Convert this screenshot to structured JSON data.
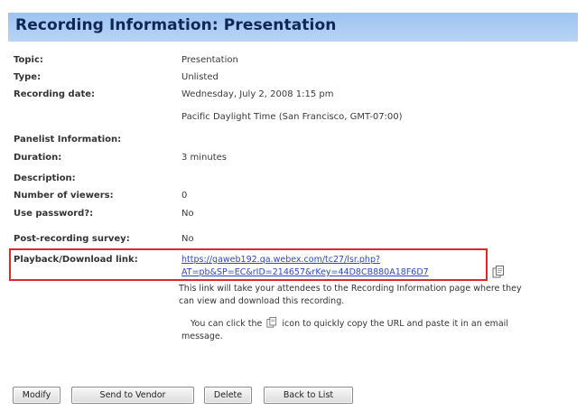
{
  "header": {
    "title": "Recording Information: Presentation"
  },
  "fields": {
    "topic": {
      "label": "Topic:",
      "value": "Presentation"
    },
    "type": {
      "label": "Type:",
      "value": "Unlisted"
    },
    "recording_date": {
      "label": "Recording date:",
      "value": "Wednesday, July 2, 2008 1:15 pm",
      "timezone": "Pacific Daylight Time (San Francisco, GMT-07:00)"
    },
    "panelist_info": {
      "label": "Panelist Information:",
      "value": ""
    },
    "duration": {
      "label": "Duration:",
      "value": "3 minutes"
    },
    "description": {
      "label": "Description:",
      "value": ""
    },
    "viewers": {
      "label": "Number of viewers:",
      "value": "0"
    },
    "use_password": {
      "label": "Use password?:",
      "value": "No"
    },
    "post_survey": {
      "label": "Post-recording survey:",
      "value": "No"
    },
    "playback": {
      "label": "Playback/Download link:",
      "link_line1": "https://gaweb192.qa.webex.com/tc27/lsr.php?",
      "link_line2": "AT=pb&SP=EC&rID=214657&rKey=44D8CB880A18F6D7"
    }
  },
  "info": {
    "line1": "This link will take your attendees to the Recording Information page where they",
    "line2": "can view and download this recording.",
    "tip_before": "You can click the",
    "tip_after": "icon to quickly copy the URL and paste it in an email",
    "tip_line2": "message."
  },
  "buttons": {
    "modify": "Modify",
    "send_to_vendor": "Send to Vendor",
    "delete": "Delete",
    "back_to_list": "Back to List"
  },
  "colors": {
    "header_bg": "#b8d4f5",
    "header_text": "#0e2757",
    "link": "#2b49c4",
    "highlight_border": "#e0272b"
  },
  "icons": {
    "copy": "copy-url-icon"
  }
}
